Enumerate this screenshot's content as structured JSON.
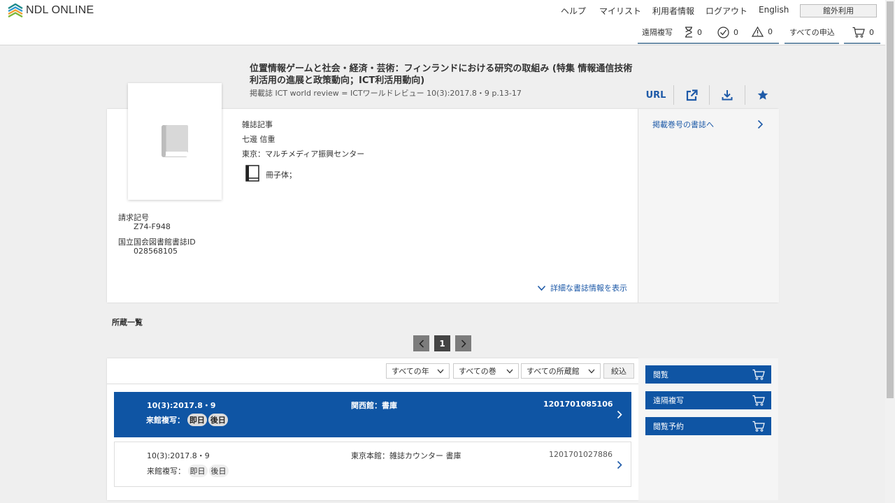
{
  "header": {
    "logo_text": "NDL ONLINE",
    "nav": [
      "ヘルプ",
      "マイリスト",
      "利用者情報",
      "ログアウト",
      "English"
    ],
    "guest_label": "館外利用",
    "toolbar": {
      "remote_copy": "遠隔複写",
      "pending_count": "0",
      "done_count": "0",
      "warn_count": "0",
      "all_requests": "すべての申込",
      "cart_count": "0"
    }
  },
  "record": {
    "title": "位置情報ゲームと社会・経済・芸術：フィンランドにおける研究の取組み (特集 情報通信技術利活用の進展と政策動向；ICT利活用動向)",
    "subtitle": "掲載誌 ICT world review = ICTワールドレビュー 10(3):2017.8・9 p.13-17",
    "actions": {
      "url": "URL"
    },
    "type": "雑誌記事",
    "author": "七邊 信重",
    "publisher": "東京：マルチメディア振興センター",
    "format": "冊子体；",
    "call_number_label": "請求記号",
    "call_number": "Z74-F948",
    "ndl_id_label": "国立国会図書館書誌ID",
    "ndl_id": "028568105",
    "more_link": "詳細な書誌情報を表示",
    "issue_link": "掲載巻号の書誌へ"
  },
  "holdings": {
    "title": "所蔵一覧",
    "page": "1",
    "filters": {
      "year": "すべての年",
      "volume": "すべての巻",
      "library": "すべての所蔵館",
      "apply": "絞込"
    },
    "copy_label": "来館複写：",
    "items": [
      {
        "issue": "10(3):2017.8・9",
        "location": "関西館：書庫",
        "id": "1201701085106",
        "badge1": "即日",
        "badge2": "後日"
      },
      {
        "issue": "10(3):2017.8・9",
        "location": "東京本館：雑誌カウンター 書庫",
        "id": "1201701027886",
        "badge1": "即日",
        "badge2": "後日"
      }
    ],
    "side_buttons": [
      "閲覧",
      "遠隔複写",
      "閲覧予約"
    ]
  }
}
